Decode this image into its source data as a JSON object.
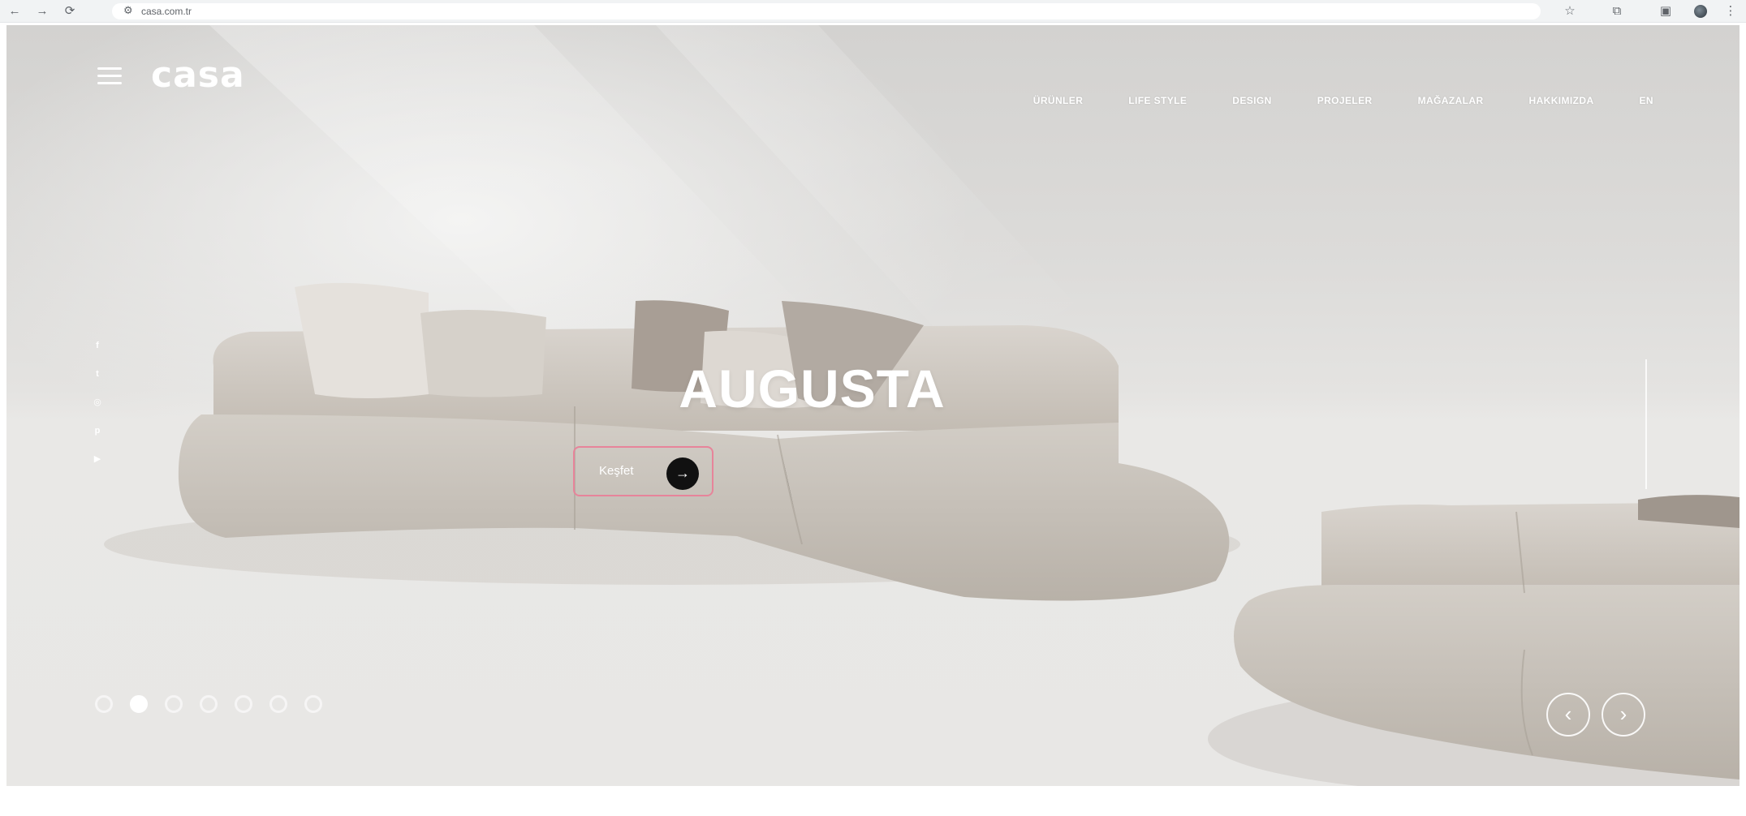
{
  "browser": {
    "url": "casa.com.tr",
    "back": "←",
    "forward": "→",
    "reload": "⟳"
  },
  "site": {
    "logo": "casa",
    "nav": [
      "ÜRÜNLER",
      "LIFE STYLE",
      "DESIGN",
      "PROJELER",
      "MAĞAZALAR",
      "HAKKIMIZDA",
      "EN"
    ]
  },
  "hero": {
    "title": "AUGUSTA",
    "cta_label": "Keşfet",
    "cta_arrow": "→",
    "slides_count": 7,
    "active_slide": 2,
    "prev": "‹",
    "next": "›"
  },
  "social": [
    "facebook-icon",
    "twitter-icon",
    "instagram-icon",
    "pinterest-icon",
    "youtube-icon"
  ],
  "colors": {
    "cta_border": "#e7849a",
    "cta_circle": "#111111",
    "sofa": "#c9c3bb",
    "background": "#e4e3e1"
  }
}
